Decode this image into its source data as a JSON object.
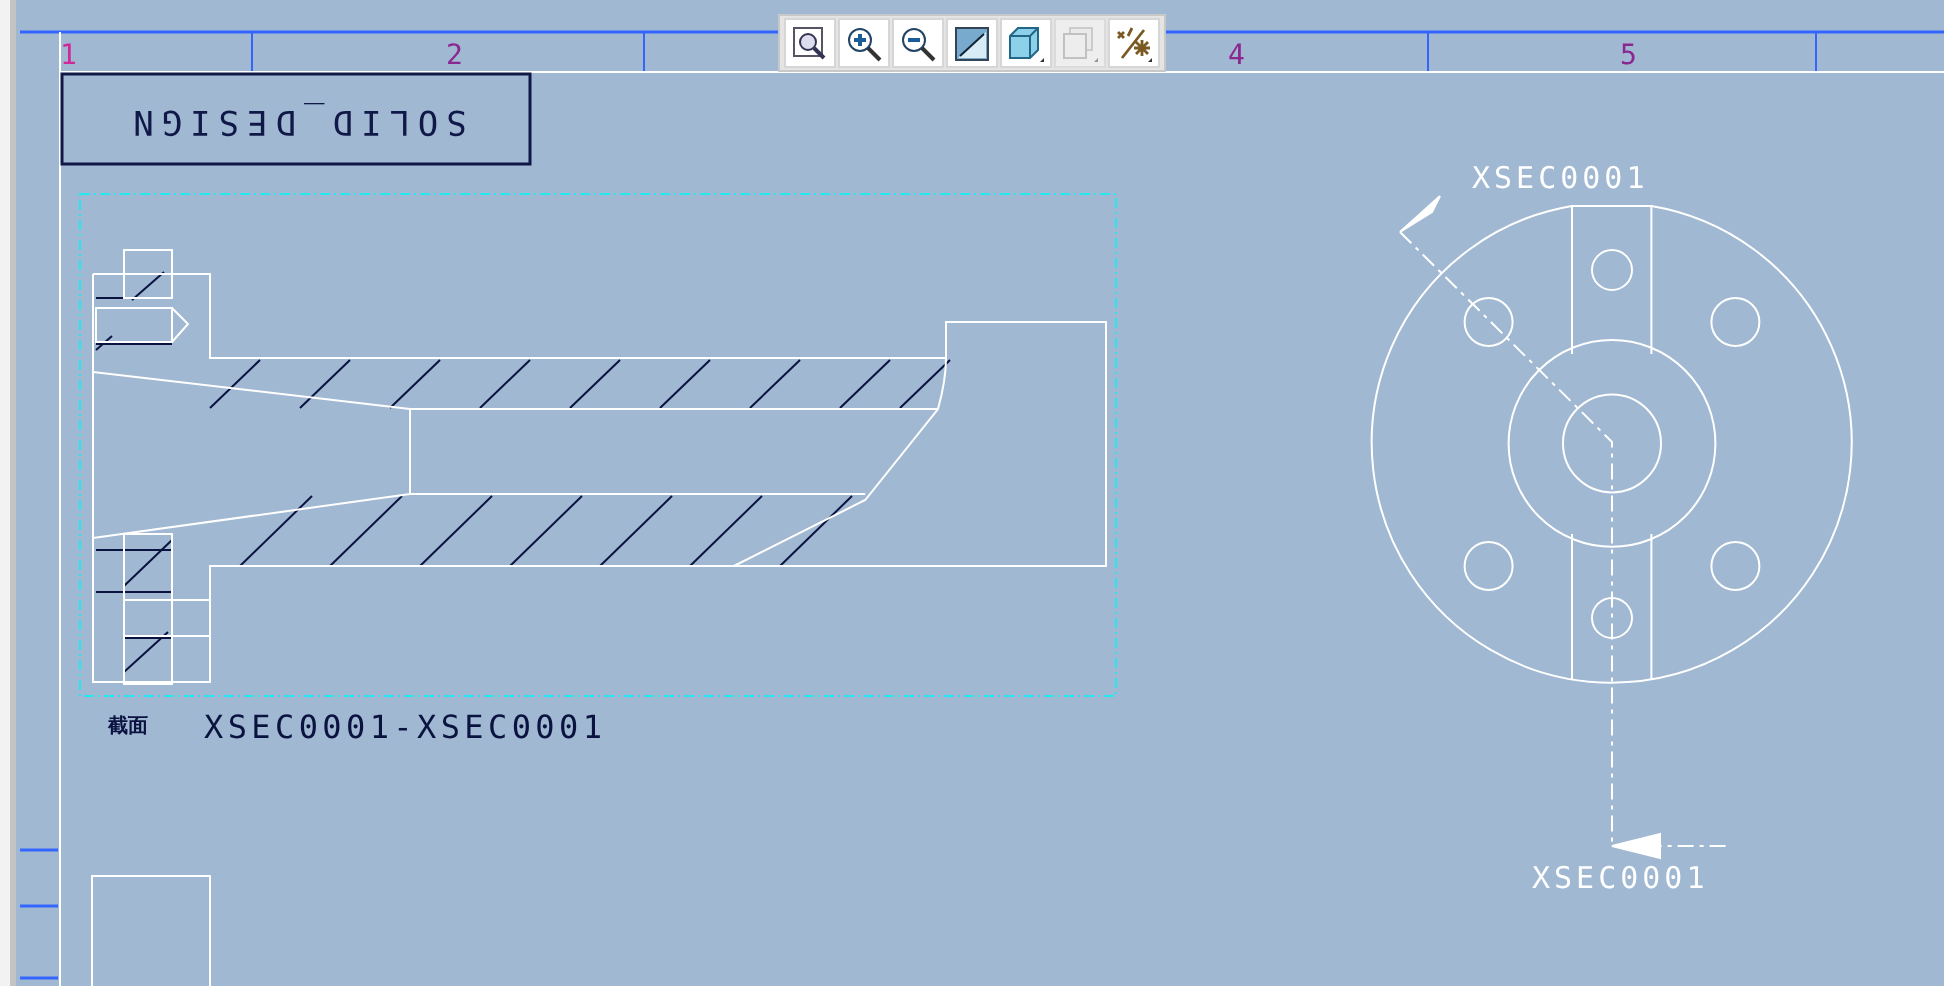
{
  "sheet": {
    "zones": [
      {
        "label": "1"
      },
      {
        "label": "2"
      },
      {
        "label": "4"
      },
      {
        "label": "5"
      }
    ],
    "title_block": {
      "text": "SOLID_DESIGN"
    },
    "section_view": {
      "caption": "截面",
      "name": "XSEC0001-XSEC0001"
    },
    "end_view": {
      "cutting_plane_labels": [
        "XSEC0001",
        "XSEC0001"
      ]
    }
  },
  "toolbar": [
    {
      "kind": "refit",
      "disabled": false
    },
    {
      "kind": "zoom-in",
      "disabled": false
    },
    {
      "kind": "zoom-out",
      "disabled": false
    },
    {
      "kind": "repaint",
      "disabled": false
    },
    {
      "kind": "display-style",
      "disabled": false
    },
    {
      "kind": "view-manager",
      "disabled": true
    },
    {
      "kind": "datum-display",
      "disabled": false
    }
  ]
}
